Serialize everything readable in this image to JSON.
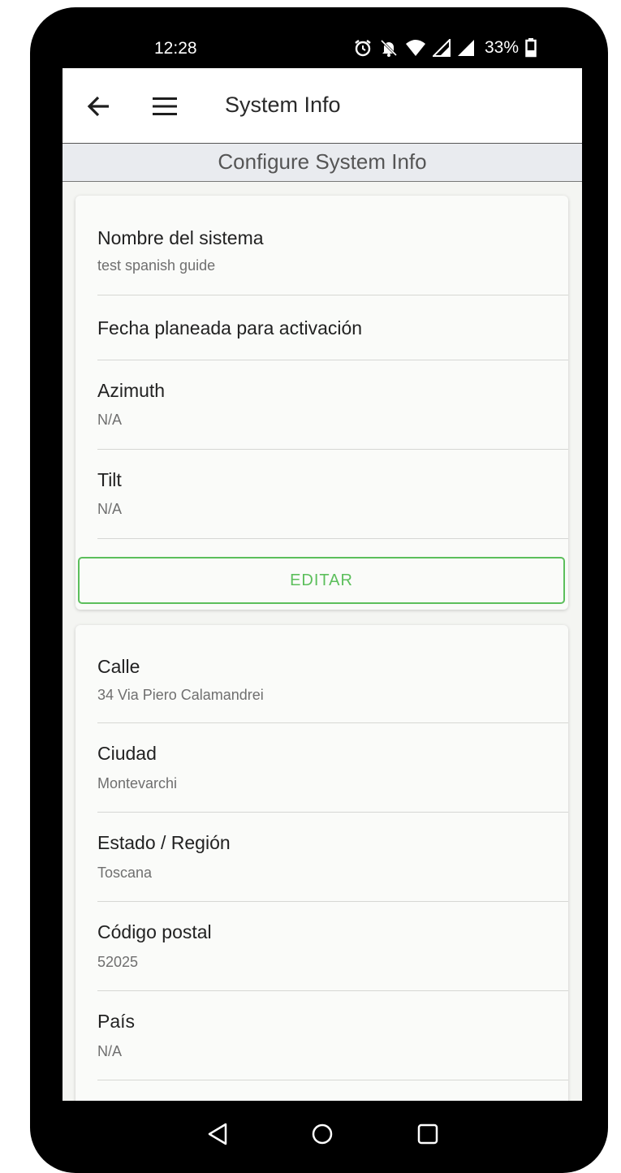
{
  "status": {
    "time": "12:28",
    "battery": "33%",
    "icons": [
      "alarm-icon",
      "bell-off-icon",
      "wifi-icon",
      "signal-icon",
      "signal-icon",
      "battery-icon"
    ]
  },
  "appbar": {
    "title": "System Info",
    "back_icon": "arrow-left-icon",
    "menu_icon": "hamburger-menu-icon"
  },
  "subheader": {
    "title": "Configure System Info"
  },
  "card1": {
    "fields": [
      {
        "label": "Nombre del sistema",
        "value": "test spanish guide"
      },
      {
        "label": "Fecha planeada para activación",
        "value": ""
      },
      {
        "label": "Azimuth",
        "value": "N/A"
      },
      {
        "label": "Tilt",
        "value": "N/A"
      }
    ],
    "edit_label": "EDITAR"
  },
  "card2": {
    "fields": [
      {
        "label": "Calle",
        "value": "34 Via Piero Calamandrei"
      },
      {
        "label": "Ciudad",
        "value": "Montevarchi"
      },
      {
        "label": "Estado / Región",
        "value": "Toscana"
      },
      {
        "label": "Código postal",
        "value": "52025"
      },
      {
        "label": "País",
        "value": "N/A"
      }
    ]
  },
  "colors": {
    "accent_green": "#5cbf5c",
    "screen_bg": "#f4f5f2",
    "subheader_bg": "#e9ebef"
  }
}
